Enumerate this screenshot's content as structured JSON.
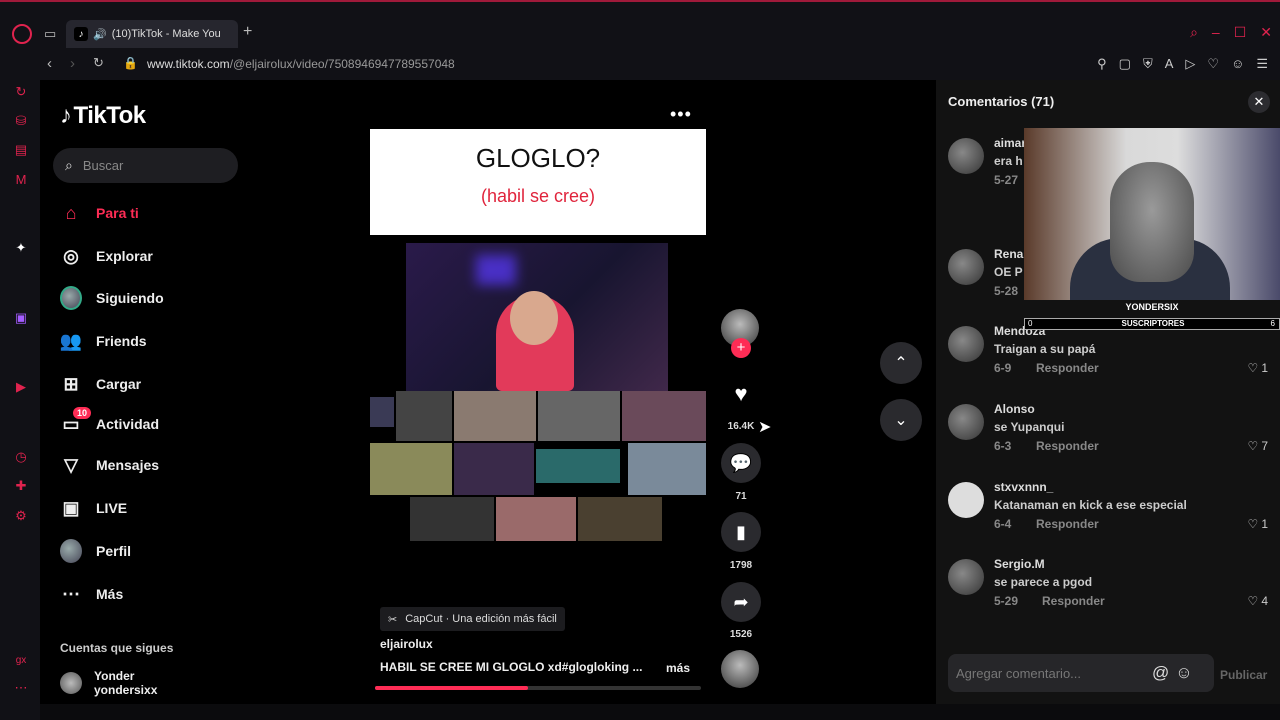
{
  "browser": {
    "tab_title": "(10)TikTok - Make You",
    "url_domain": "www.tiktok.com",
    "url_path": "/@eljairolux/video/7508946947789557048"
  },
  "sidebar": {
    "logo": "TikTok",
    "search_placeholder": "Buscar",
    "items": [
      {
        "label": "Para ti",
        "icon": "home-icon"
      },
      {
        "label": "Explorar",
        "icon": "compass-icon"
      },
      {
        "label": "Siguiendo",
        "icon": "following-avatar-icon"
      },
      {
        "label": "Friends",
        "icon": "friends-icon"
      },
      {
        "label": "Cargar",
        "icon": "upload-icon"
      },
      {
        "label": "Actividad",
        "icon": "activity-icon",
        "badge": "10"
      },
      {
        "label": "Mensajes",
        "icon": "send-icon"
      },
      {
        "label": "LIVE",
        "icon": "live-icon"
      },
      {
        "label": "Perfil",
        "icon": "profile-avatar-icon"
      },
      {
        "label": "Más",
        "icon": "more-dots-icon"
      }
    ],
    "following_title": "Cuentas que sigues",
    "following": [
      {
        "name": "Yonder",
        "handle": "yondersixx"
      }
    ]
  },
  "video": {
    "caption_title": "GLOGLO?",
    "caption_sub": "(habil se cree)",
    "capcut": "CapCut · Una edición más fácil",
    "username": "eljairolux",
    "description": "HABIL SE CREE MI GLOGLO xd#glogloking ...",
    "more": "más",
    "progress": 0.47
  },
  "actions": {
    "likes": "16.4K",
    "comments": "71",
    "saves": "1798",
    "shares": "1526"
  },
  "comments_panel": {
    "title": "Comentarios (71)",
    "reply_label": "Responder",
    "input_placeholder": "Agregar comentario...",
    "publish": "Publicar",
    "items": [
      {
        "user": "aimar",
        "text": "era h",
        "date": "5-27",
        "likes": ""
      },
      {
        "user": "Rena",
        "text": "OE P",
        "date": "5-28",
        "likes": ""
      },
      {
        "user": "Mendoza",
        "text": "Traigan a su papá",
        "date": "6-9",
        "likes": "1"
      },
      {
        "user": "Alonso",
        "text": "se Yupanqui",
        "date": "6-3",
        "likes": "7"
      },
      {
        "user": "stxvxnnn_",
        "text": "Katanaman en kick a ese especial",
        "date": "6-4",
        "likes": "1"
      },
      {
        "user": "Sergio.M",
        "text": "se parece a pgod",
        "date": "5-29",
        "likes": "4"
      }
    ]
  },
  "overlay": {
    "name": "YONDERSIX",
    "bar_label": "SUSCRIPTORES",
    "bar_left": "0",
    "bar_right": "6"
  }
}
